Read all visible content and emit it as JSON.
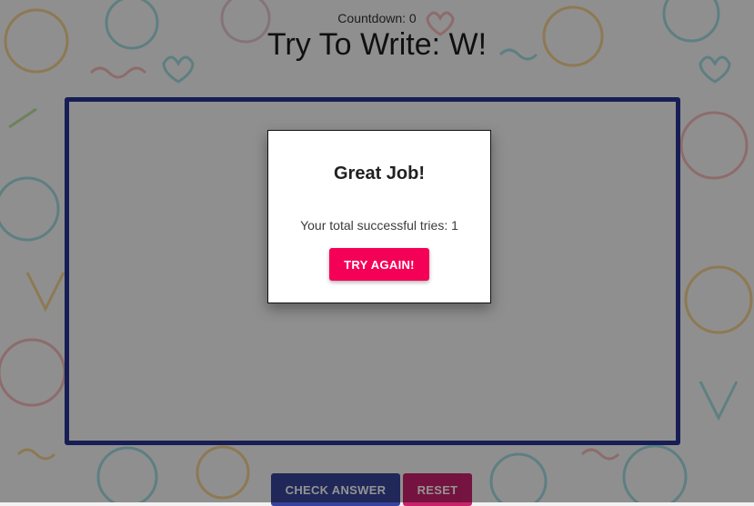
{
  "header": {
    "countdown": "Countdown: 0",
    "title": "Try To Write: W!"
  },
  "dialog": {
    "title": "Great Job!",
    "message": "Your total successful tries: 1",
    "try_again_label": "TRY AGAIN!"
  },
  "controls": {
    "check_answer_label": "CHECK ANSWER",
    "reset_label": "RESET"
  },
  "colors": {
    "board_border": "#283593",
    "primary": "#283593",
    "accent": "#f50057",
    "reset": "#c51162"
  },
  "icons": {
    "background": "kids-doodle-pattern"
  }
}
